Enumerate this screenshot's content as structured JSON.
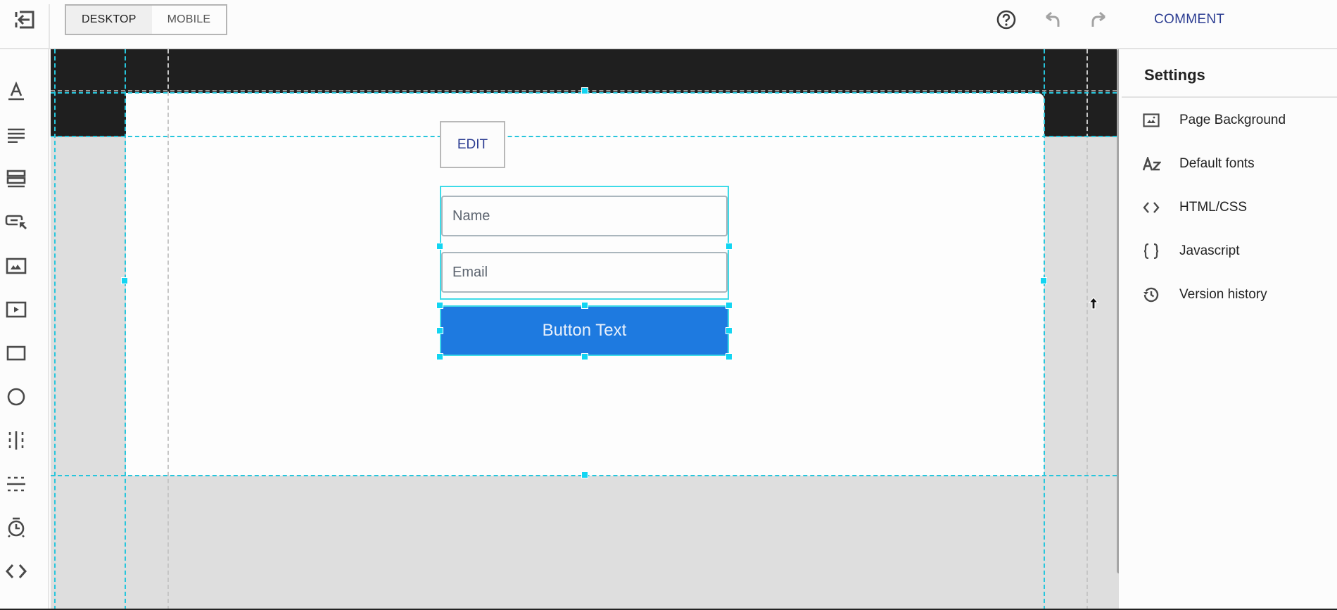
{
  "topbar": {
    "exit_icon": "exit-arrow-icon",
    "view_modes": [
      {
        "label": "DESKTOP",
        "active": true
      },
      {
        "label": "MOBILE",
        "active": false
      }
    ],
    "help_icon": "help-circle-icon",
    "undo_icon": "undo-icon",
    "redo_icon": "redo-icon",
    "comment_label": "COMMENT"
  },
  "left_toolbar": {
    "tools": [
      {
        "name": "text",
        "icon": "text-icon"
      },
      {
        "name": "paragraph",
        "icon": "paragraph-icon"
      },
      {
        "name": "form",
        "icon": "form-icon"
      },
      {
        "name": "button",
        "icon": "button-cursor-icon"
      },
      {
        "name": "image",
        "icon": "image-icon"
      },
      {
        "name": "video",
        "icon": "video-icon"
      },
      {
        "name": "box",
        "icon": "rectangle-icon"
      },
      {
        "name": "circle",
        "icon": "circle-icon"
      },
      {
        "name": "vertical-line",
        "icon": "vertical-line-icon"
      },
      {
        "name": "horizontal-line",
        "icon": "horizontal-line-icon"
      },
      {
        "name": "timer",
        "icon": "timer-icon"
      },
      {
        "name": "code",
        "icon": "code-icon"
      }
    ]
  },
  "canvas": {
    "edit_label": "EDIT",
    "form": {
      "fields": [
        {
          "placeholder": "Name"
        },
        {
          "placeholder": "Email"
        }
      ],
      "button_label": "Button Text",
      "button_color": "#1e7ae0"
    },
    "selection_color": "#12d5f2"
  },
  "settings_panel": {
    "title": "Settings",
    "items": [
      {
        "label": "Page Background",
        "icon": "image-icon"
      },
      {
        "label": "Default fonts",
        "icon": "font-az-icon"
      },
      {
        "label": "HTML/CSS",
        "icon": "code-icon"
      },
      {
        "label": "Javascript",
        "icon": "curly-braces-icon"
      },
      {
        "label": "Version history",
        "icon": "history-icon"
      }
    ]
  },
  "colors": {
    "accent": "#2c3d92",
    "dark_band": "#1f1f1f",
    "canvas_bg": "#dedede"
  }
}
